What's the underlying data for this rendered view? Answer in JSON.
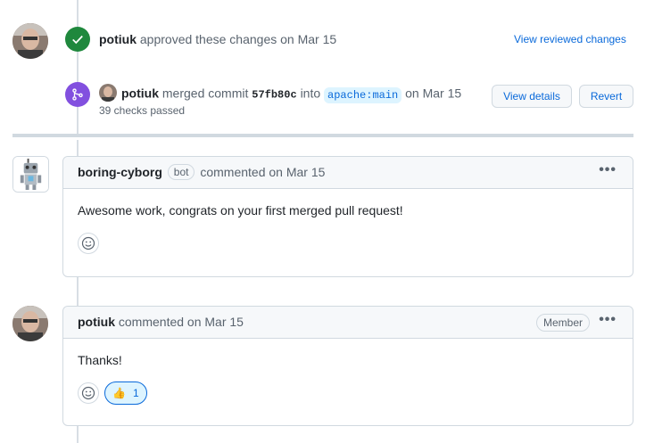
{
  "events": {
    "approval": {
      "author": "potiuk",
      "action": "approved these changes on Mar 15",
      "link": "View reviewed changes"
    },
    "merge": {
      "author": "potiuk",
      "action_prefix": "merged commit",
      "sha": "57fb80c",
      "into": "into",
      "branch": "apache:main",
      "date": "on Mar 15",
      "checks": "39 checks passed",
      "view_details": "View details",
      "revert": "Revert"
    }
  },
  "comments": [
    {
      "author": "boring-cyborg",
      "label": "bot",
      "meta": "commented on Mar 15",
      "body": "Awesome work, congrats on your first merged pull request!",
      "more": "•••"
    },
    {
      "author": "potiuk",
      "meta": "commented on Mar 15",
      "role": "Member",
      "body": "Thanks!",
      "more": "•••",
      "reaction": {
        "emoji": "👍",
        "count": "1"
      }
    }
  ],
  "colors": {
    "approved_green": "#1f883d",
    "merged_purple": "#8250df",
    "link_blue": "#0969da"
  }
}
